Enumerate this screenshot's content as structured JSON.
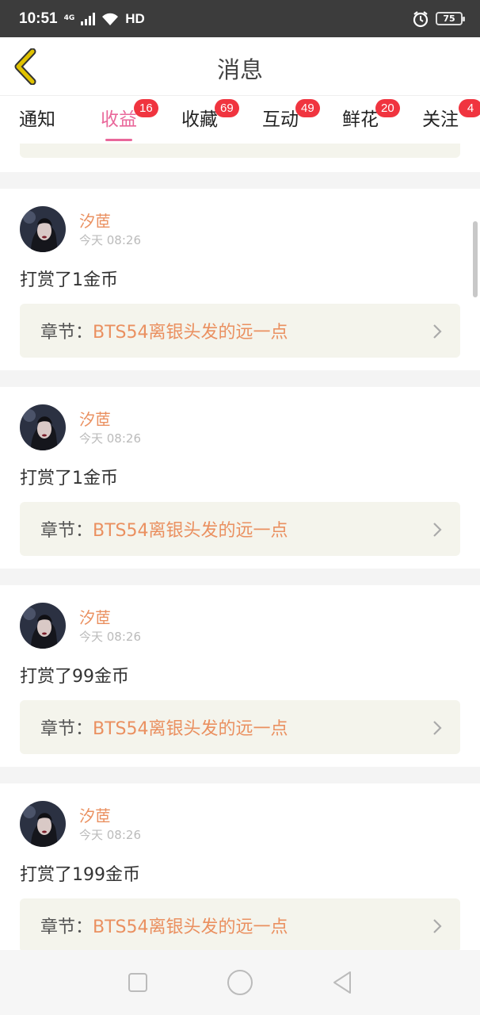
{
  "status": {
    "time": "10:51",
    "network": "4G",
    "hd": "HD",
    "battery": "75"
  },
  "header": {
    "title": "消息",
    "back_icon": "chevron-left-icon"
  },
  "tabs": [
    {
      "label": "通知",
      "badge": ""
    },
    {
      "label": "收益",
      "badge": "16",
      "active": true
    },
    {
      "label": "收藏",
      "badge": "69"
    },
    {
      "label": "互动",
      "badge": "49"
    },
    {
      "label": "鲜花",
      "badge": "20"
    },
    {
      "label": "关注",
      "badge": "4"
    }
  ],
  "messages": [
    {
      "user": "汐茝",
      "time": "今天 08:26",
      "text": "打赏了1金币",
      "chapter_prefix": "章节：",
      "chapter_title": "BTS54离银头发的远一点"
    },
    {
      "user": "汐茝",
      "time": "今天 08:26",
      "text": "打赏了1金币",
      "chapter_prefix": "章节：",
      "chapter_title": "BTS54离银头发的远一点"
    },
    {
      "user": "汐茝",
      "time": "今天 08:26",
      "text": "打赏了99金币",
      "chapter_prefix": "章节：",
      "chapter_title": "BTS54离银头发的远一点"
    },
    {
      "user": "汐茝",
      "time": "今天 08:26",
      "text": "打赏了199金币",
      "chapter_prefix": "章节：",
      "chapter_title": "BTS54离银头发的远一点"
    }
  ],
  "colors": {
    "accent_pink": "#e9679a",
    "badge_red": "#f0343f",
    "name_orange": "#ea9060",
    "back_yellow": "#c8a800"
  }
}
